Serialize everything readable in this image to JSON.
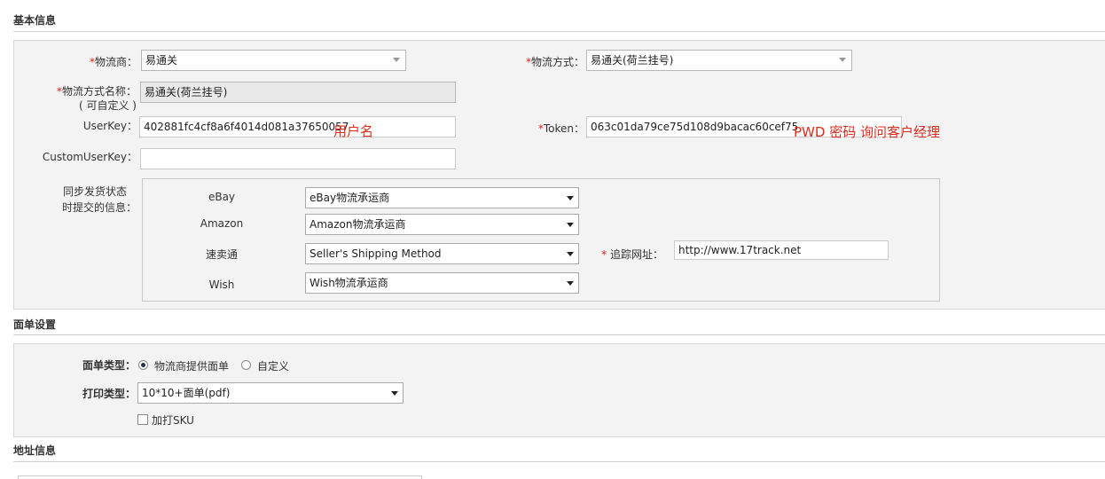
{
  "sections": {
    "basic": "基本信息",
    "waybill": "面单设置",
    "address": "地址信息"
  },
  "basic": {
    "carrier_label": "物流商：",
    "carrier_value": "易通关",
    "method_label": "物流方式：",
    "method_value": "易通关(荷兰挂号)",
    "method_name_label": "物流方式名称：",
    "method_name_sub": "( 可自定义 )",
    "method_name_value": "易通关(荷兰挂号)",
    "userkey_label": "UserKey：",
    "userkey_value": "402881fc4cf8a6f4014d081a37650057",
    "userkey_note": "用户名",
    "token_label": "Token：",
    "token_value": "063c01da79ce75d108d9bacac60cef75",
    "token_note": "PWD 密码 询问客户经理",
    "custom_userkey_label": "CustomUserKey：",
    "custom_userkey_value": "",
    "sync_label_1": "同步发货状态",
    "sync_label_2": "时提交的信息：",
    "platforms": [
      {
        "name": "eBay",
        "value": "eBay物流承运商"
      },
      {
        "name": "Amazon",
        "value": "Amazon物流承运商"
      },
      {
        "name": "速卖通",
        "value": "Seller's Shipping Method"
      },
      {
        "name": "Wish",
        "value": "Wish物流承运商"
      }
    ],
    "tracking_label": "追踪网址：",
    "tracking_value": "http://www.17track.net",
    "required_mark": "*"
  },
  "waybill": {
    "type_label": "面单类型：",
    "type_options": [
      "物流商提供面单",
      "自定义"
    ],
    "type_selected": "物流商提供面单",
    "print_label": "打印类型：",
    "print_value": "10*10+面单(pdf)",
    "sku_label": "加打SKU",
    "sku_checked": false
  }
}
